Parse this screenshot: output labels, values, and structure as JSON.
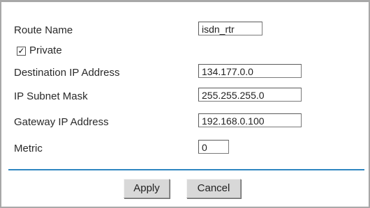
{
  "form": {
    "route_name_label": "Route Name",
    "route_name_value": "isdn_rtr",
    "private_label": "Private",
    "private_checked": true,
    "private_check_glyph": "✓",
    "dest_ip_label": "Destination IP Address",
    "dest_ip_value": "134.177.0.0",
    "subnet_label": "IP Subnet Mask",
    "subnet_value": "255.255.255.0",
    "gateway_label": "Gateway IP Address",
    "gateway_value": "192.168.0.100",
    "metric_label": "Metric",
    "metric_value": "0"
  },
  "buttons": {
    "apply_label": "Apply",
    "cancel_label": "Cancel"
  },
  "colors": {
    "divider": "#2e86c1"
  }
}
